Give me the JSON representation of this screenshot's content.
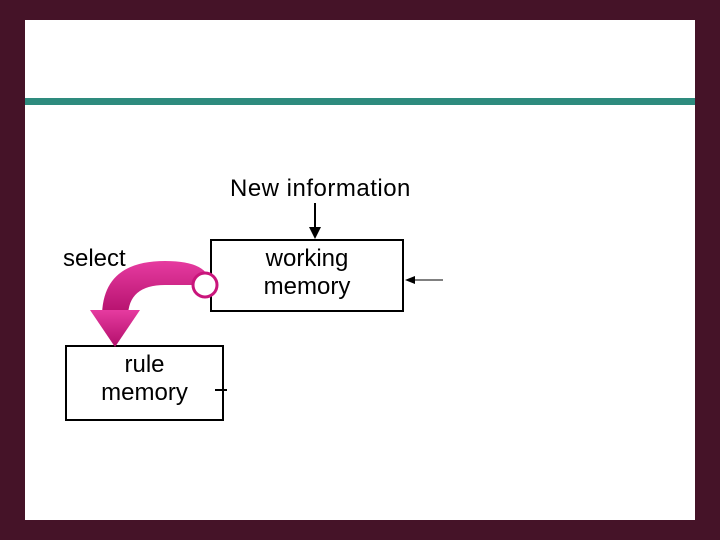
{
  "labels": {
    "newInfo": "New information",
    "select": "select"
  },
  "boxes": {
    "working": "working\nmemory",
    "rule": "rule\nmemory"
  },
  "colors": {
    "accent": "#C9157B",
    "rule": "#2E8B7E",
    "pageBg": "#451328"
  }
}
